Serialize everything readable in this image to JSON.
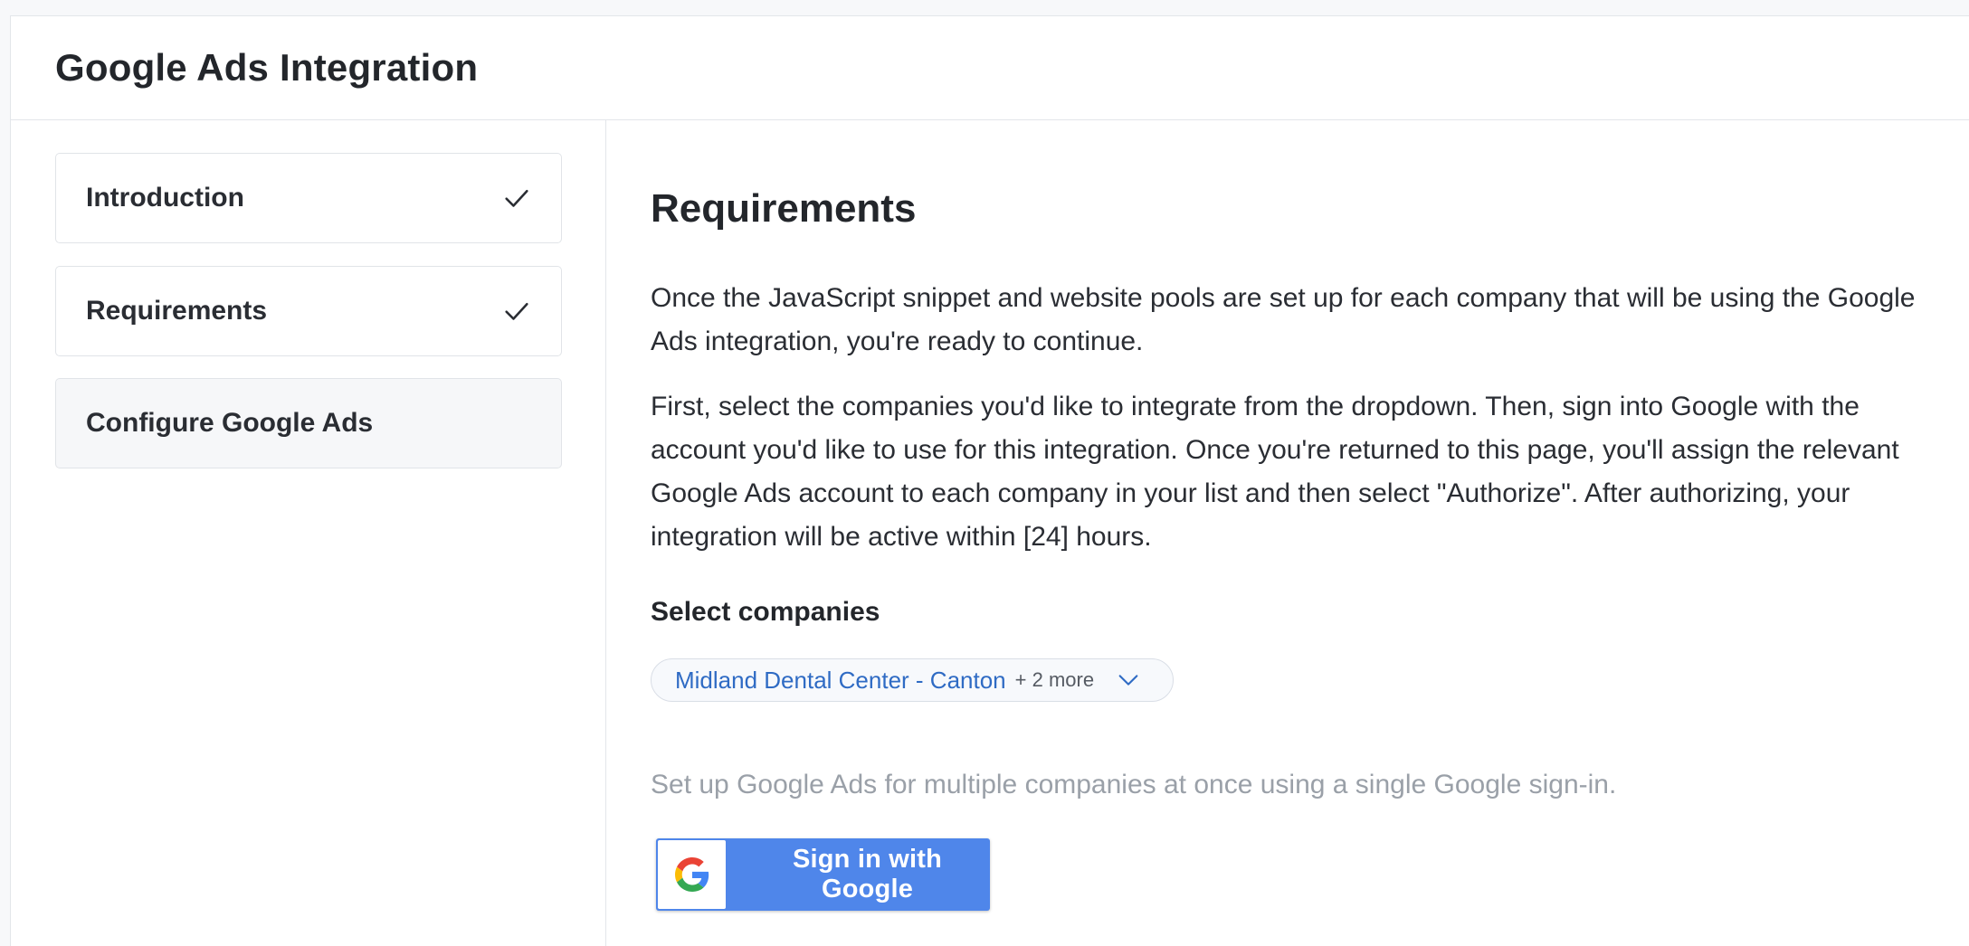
{
  "header": {
    "title": "Google Ads Integration"
  },
  "sidebar": {
    "steps": [
      {
        "label": "Introduction",
        "completed": true
      },
      {
        "label": "Requirements",
        "completed": true
      },
      {
        "label": "Configure Google Ads",
        "completed": false
      }
    ]
  },
  "main": {
    "section_title": "Requirements",
    "paragraphs": [
      "Once the JavaScript snippet and website pools are set up for each company that will be using the Google Ads integration, you're ready to continue.",
      "First, select the companies you'd like to integrate from the dropdown. Then, sign into Google with the account you'd like to use for this integration. Once you're returned to this page, you'll assign the relevant Google Ads account to each company in your list and then select \"Authorize\". After authorizing, your integration will be active within [24] hours."
    ],
    "select_label": "Select companies",
    "company_select": {
      "selected": "Midland Dental Center - Canton",
      "more": "+ 2 more",
      "icon": "chevron-down-icon"
    },
    "helper_text": "Set up Google Ads for multiple companies at once using a single Google sign-in.",
    "google_button": {
      "label": "Sign in with Google",
      "icon": "google-g-icon"
    }
  },
  "colors": {
    "accent_blue": "#4f86ea",
    "link_blue": "#2f6bc4",
    "muted_text": "#9aa0a8",
    "border": "#e3e6ea"
  }
}
